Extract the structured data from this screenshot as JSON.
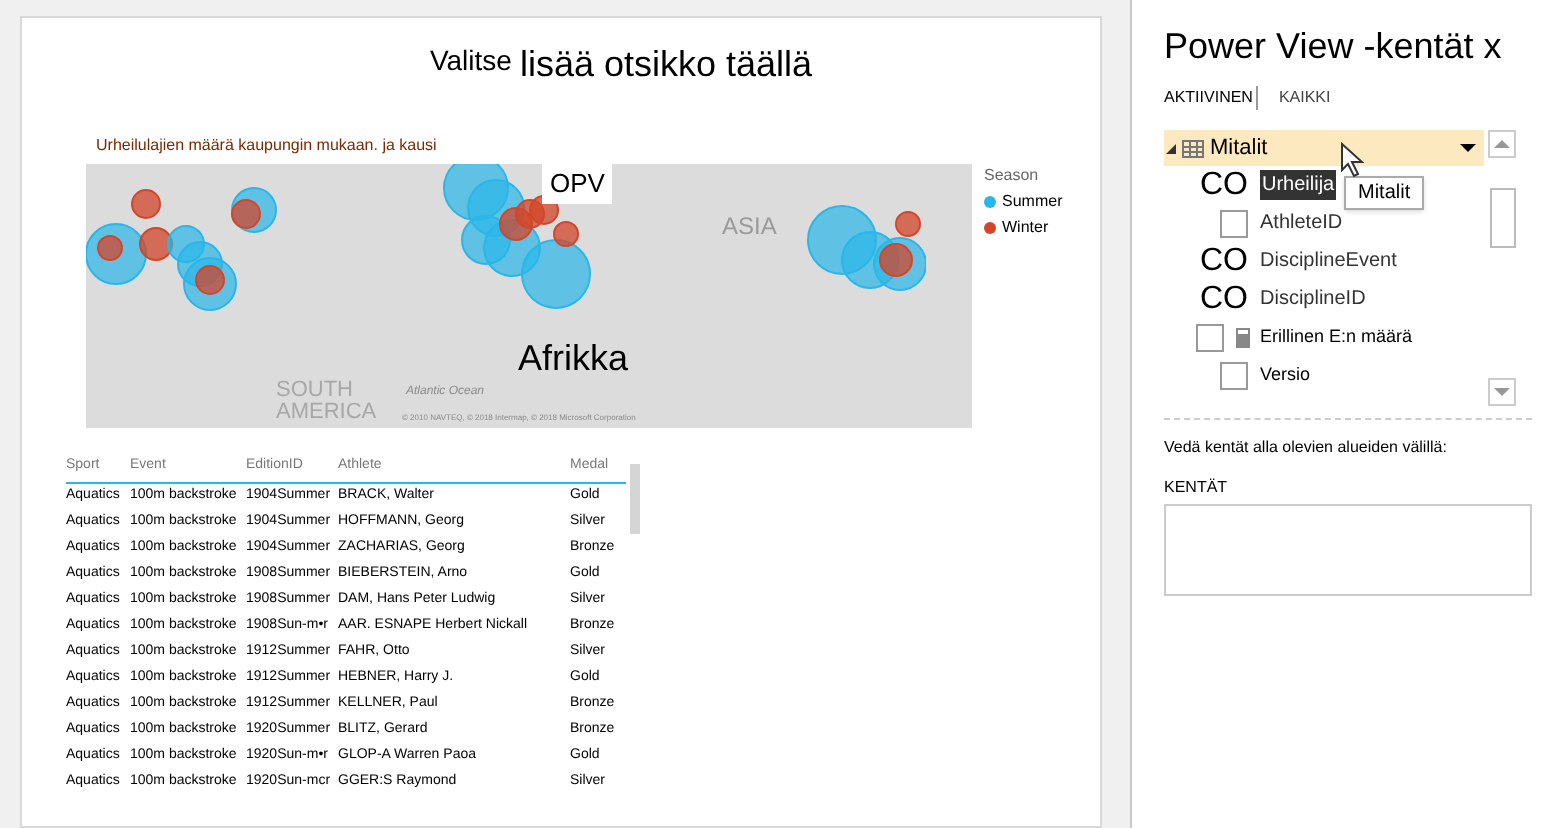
{
  "canvas": {
    "title_prefix": "Valitse",
    "title": "lisää otsikko täällä"
  },
  "map": {
    "subtitle": "Urheilulajien määrä kaupungin mukaan. ja kausi",
    "labels": [
      {
        "kind": "region",
        "text": "OPV"
      },
      {
        "kind": "continent",
        "text": "Afrikka"
      },
      {
        "kind": "faint",
        "text": "ASIA"
      },
      {
        "kind": "faint2",
        "text": "SOUTH AMERICA"
      },
      {
        "kind": "ocean",
        "text": "Atlantic Ocean"
      },
      {
        "kind": "copyright",
        "text": "© 2010 NAVTEQ, © 2018 Intermap, © 2018 Microsoft Corporation"
      }
    ],
    "legend": {
      "title": "Season",
      "items": [
        {
          "label": "Summer",
          "color": "#29b6e8"
        },
        {
          "label": "Winter",
          "color": "#d2462a"
        }
      ]
    }
  },
  "table": {
    "columns": [
      "Sport",
      "Event",
      "EditionID",
      "Athlete",
      "Medal"
    ],
    "rows": [
      [
        "Aquatics",
        "100m backstroke",
        "1904Summer",
        "BRACK, Walter",
        "Gold"
      ],
      [
        "Aquatics",
        "100m backstroke",
        "1904Summer",
        "HOFFMANN, Georg",
        "Silver"
      ],
      [
        "Aquatics",
        "100m backstroke",
        "1904Summer",
        "ZACHARIAS, Georg",
        "Bronze"
      ],
      [
        "Aquatics",
        "100m backstroke",
        "1908Summer",
        "BIEBERSTEIN, Arno",
        "Gold"
      ],
      [
        "Aquatics",
        "100m backstroke",
        "1908Summer",
        "DAM, Hans Peter Ludwig",
        "Silver"
      ],
      [
        "Aquatics",
        "100m backstroke",
        "1908Sun-m•r",
        "AAR. ESNAPE Herbert Nickall",
        "Bronze"
      ],
      [
        "Aquatics",
        "100m backstroke",
        "1912Summer",
        "FAHR, Otto",
        "Silver"
      ],
      [
        "Aquatics",
        "100m backstroke",
        "1912Summer",
        "HEBNER, Harry J.",
        "Gold"
      ],
      [
        "Aquatics",
        "100m backstroke",
        "1912Summer",
        "KELLNER, Paul",
        "Bronze"
      ],
      [
        "Aquatics",
        "100m backstroke",
        "1920Summer",
        "BLITZ, Gerard",
        "Bronze"
      ],
      [
        "Aquatics",
        "100m backstroke",
        "1920Sun-m•r",
        "GLOP-A Warren Paoa",
        "Gold"
      ],
      [
        "Aquatics",
        "100m backstroke",
        "1920Sun-mcr",
        "GGER:S Raymond",
        "Silver"
      ]
    ]
  },
  "panel": {
    "title": "Power View -kentät x",
    "tabs": [
      {
        "label": "AKTIIVINEN",
        "selected": true
      },
      {
        "label": "KAIKKI",
        "selected": false
      }
    ],
    "table_name": "Mitalit",
    "expanded": true,
    "tooltip": "Mitalit",
    "fields": [
      {
        "kind": "co",
        "mark": "CO",
        "name": "Urheilija",
        "highlighted": true
      },
      {
        "kind": "checkbox",
        "name": "AthleteID",
        "highlighted": false,
        "checked": false
      },
      {
        "kind": "co",
        "mark": "CO",
        "name": "DisciplineEvent",
        "highlighted": false
      },
      {
        "kind": "co",
        "mark": "CO",
        "name": "DisciplineID",
        "highlighted": false
      },
      {
        "kind": "calc",
        "name": "Erillinen E:n määrä",
        "highlighted": false,
        "checked": false
      },
      {
        "kind": "checkbox",
        "name": "Versio",
        "highlighted": false,
        "checked": false
      }
    ],
    "hint": "Vedä kentät alla olevien alueiden välillä:",
    "area_label": "KENTÄT"
  }
}
